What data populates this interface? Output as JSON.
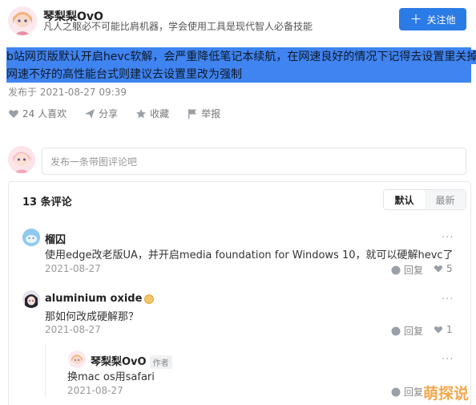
{
  "author": {
    "name": "琴梨梨OvO",
    "bio": "凡人之躯必不可能比肩机器，学会使用工具是现代智人必备技能"
  },
  "follow": {
    "label": "关注他"
  },
  "answer": {
    "line1": "b站网页版默认开启hevc软解，会严重降低笔记本续航，在网速良好的情况下记得去设置里关掉，",
    "line2": "网速不好的高性能台式则建议去设置里改为强制"
  },
  "post_meta": "发布于 2021-08-27 09:39",
  "actions": {
    "likes": "24 人喜欢",
    "share": "分享",
    "collect": "收藏",
    "report": "举报"
  },
  "comment_box": {
    "placeholder": "发布一条带图评论吧"
  },
  "comments_header": {
    "count": "13 条评论",
    "sort_default": "默认",
    "sort_latest": "最新"
  },
  "comments": [
    {
      "name": "榴囚",
      "text": "使用edge改老版UA，并开启media foundation for Windows 10，就可以硬解hevc了",
      "date": "2021-08-27",
      "reply": "回复",
      "likes": "5",
      "more": "···"
    },
    {
      "name": "aluminium oxide",
      "text": "那如何改成硬解那？",
      "date": "2021-08-27",
      "reply": "回复",
      "likes": "1",
      "more": "···"
    },
    {
      "name": "琴梨梨OvO",
      "tag": "作者",
      "text": "换mac os用safari",
      "date": "2021-08-27",
      "reply": "回复",
      "more": "···"
    }
  ],
  "watermark": "萌探说",
  "colors": {
    "accent": "#2b7be6",
    "highlight": "#3f84f0",
    "watermark": "#f19a30"
  }
}
